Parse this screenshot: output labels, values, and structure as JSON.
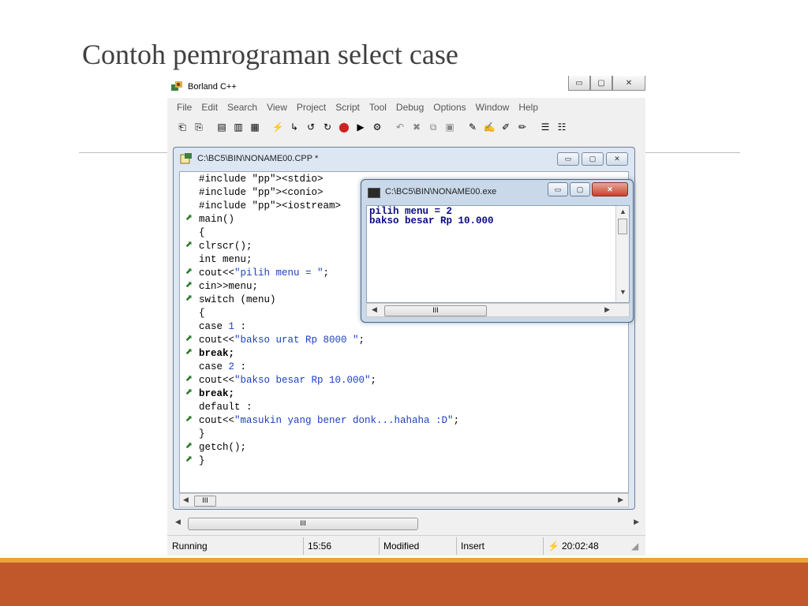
{
  "slide": {
    "title": "Contoh pemrograman select case"
  },
  "app": {
    "title": "Borland C++",
    "menu": [
      "File",
      "Edit",
      "Search",
      "View",
      "Project",
      "Script",
      "Tool",
      "Debug",
      "Options",
      "Window",
      "Help"
    ],
    "window_controls": {
      "minimize": "▭",
      "maximize": "▢",
      "close": "✕"
    }
  },
  "editor": {
    "title": "C:\\BC5\\BIN\\NONAME00.CPP *",
    "lines": [
      "#include <stdio>",
      "#include <conio>",
      "#include <iostream>",
      "main()",
      "{",
      "clrscr();",
      "int menu;",
      "cout<<\"pilih menu = \";",
      "cin>>menu;",
      "switch (menu)",
      "{",
      "case 1 :",
      "cout<<\"bakso urat Rp 8000 \";",
      "break;",
      "case 2 :",
      "cout<<\"bakso besar Rp 10.000\";",
      "break;",
      "default :",
      "cout<<\"masukin yang bener donk...hahaha :D\";",
      "}",
      "getch();",
      "}"
    ],
    "scroll_thumb": "III"
  },
  "console": {
    "title": "C:\\BC5\\BIN\\NONAME00.exe",
    "output": [
      "pilih menu = 2",
      "bakso besar Rp 10.000"
    ],
    "scroll_thumb": "III"
  },
  "app_scroll_thumb": "III",
  "status": {
    "state": "Running",
    "position": "15:56",
    "modified": "Modified",
    "mode": "Insert",
    "time": "20:02:48"
  },
  "colors": {
    "accent_band": "#c0582b",
    "accent_line": "#e8a33c",
    "code_string": "#1c3fbf",
    "code_preprocessor": "#16701a"
  }
}
